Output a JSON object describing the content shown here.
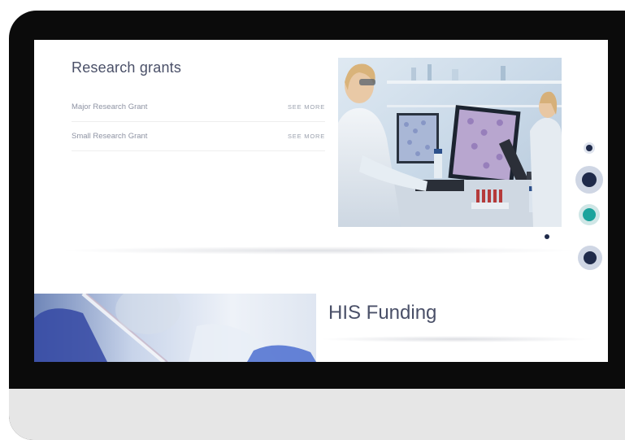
{
  "research_grants": {
    "title": "Research grants",
    "items": [
      {
        "label": "Major Research Grant",
        "action": "SEE MORE"
      },
      {
        "label": "Small Research Grant",
        "action": "SEE MORE"
      }
    ]
  },
  "funding": {
    "title": "HIS Funding"
  },
  "colors": {
    "heading": "#4a5068",
    "dot_navy": "#1f2a4a",
    "dot_teal": "#1ba39c"
  }
}
